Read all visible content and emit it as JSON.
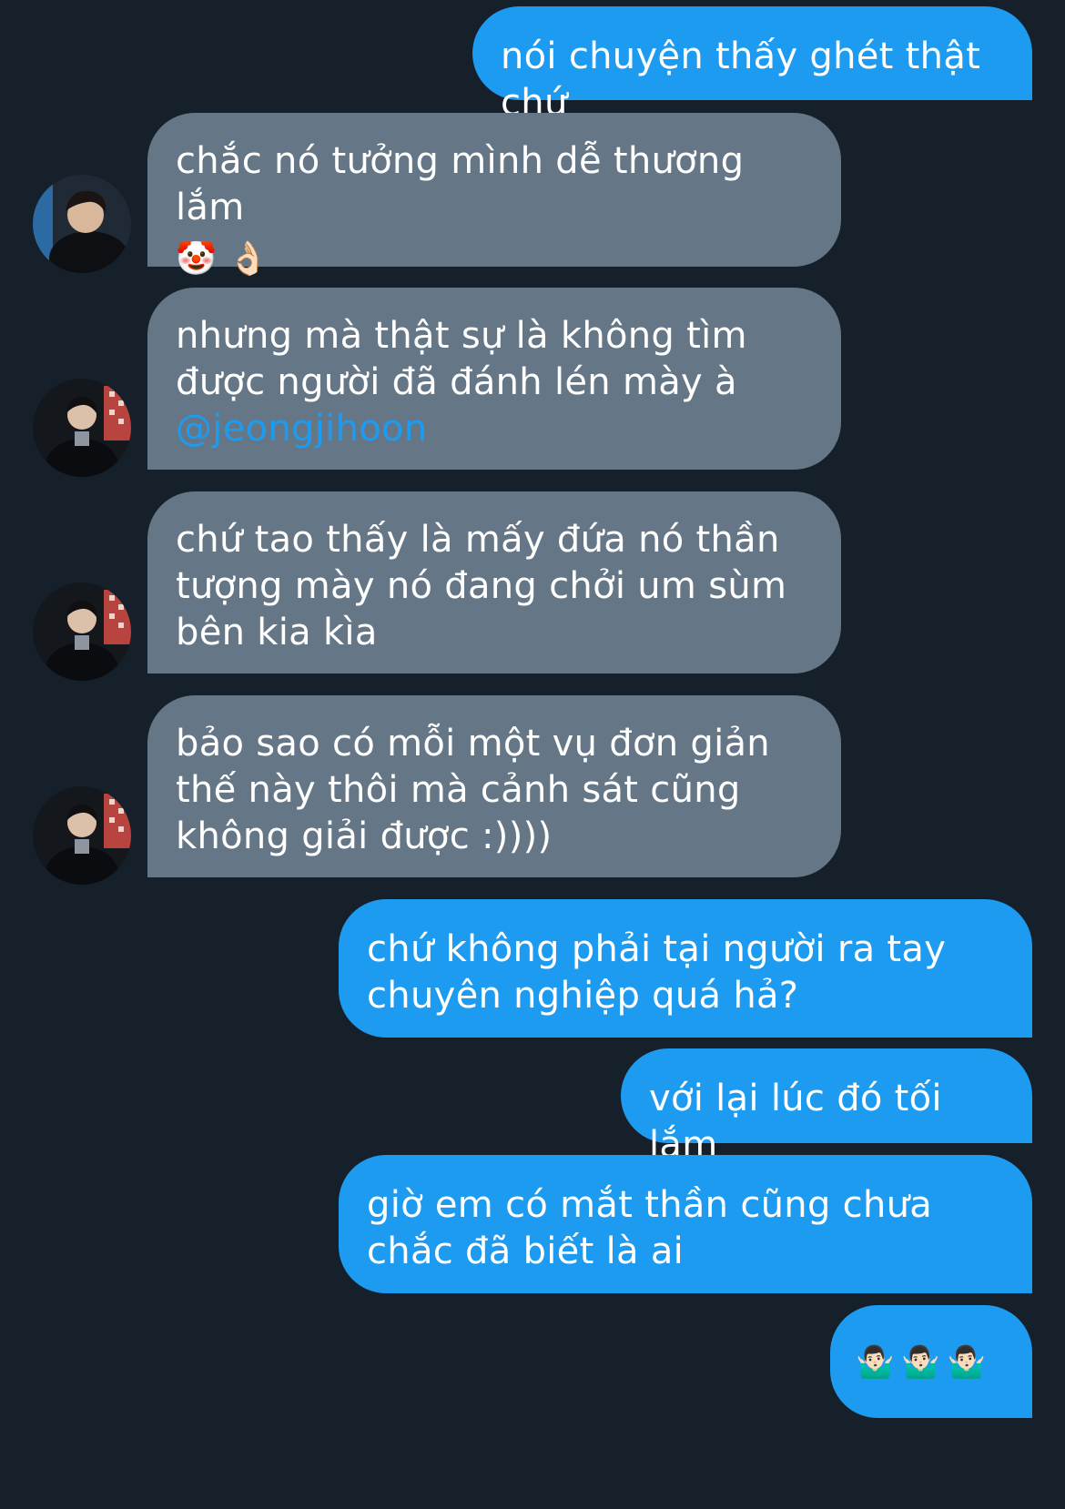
{
  "conversation": {
    "messages": [
      {
        "id": "m1",
        "direction": "sent",
        "text": "nói chuyện thấy ghét thật chứ"
      },
      {
        "id": "m2",
        "direction": "received",
        "text": "chắc nó tưởng mình dễ thương lắm",
        "emojis": [
          "🤡",
          "👌🏻"
        ],
        "avatar": "avatar-1"
      },
      {
        "id": "m3",
        "direction": "received",
        "text": "nhưng mà thật sự là không tìm được người đã đánh lén mày à",
        "mention": "@jeongjihoon",
        "avatar": "avatar-2"
      },
      {
        "id": "m4",
        "direction": "received",
        "text": "chứ tao thấy là mấy đứa nó thần tượng mày nó đang chởi um sùm bên kia kìa",
        "avatar": "avatar-2"
      },
      {
        "id": "m5",
        "direction": "received",
        "text": "bảo sao có mỗi một vụ đơn giản thế này thôi mà cảnh sát cũng không giải được :))))",
        "avatar": "avatar-2"
      },
      {
        "id": "m6",
        "direction": "sent",
        "text": "chứ không phải tại người ra tay chuyên nghiệp quá hả?"
      },
      {
        "id": "m7",
        "direction": "sent",
        "text": "với lại lúc đó tối lắm"
      },
      {
        "id": "m8",
        "direction": "sent",
        "text": "giờ em có mắt thần cũng chưa chắc đã biết là ai"
      },
      {
        "id": "m9",
        "direction": "sent",
        "text": "🤷🏻‍♂️🤷🏻‍♂️🤷🏻‍♂️"
      }
    ]
  },
  "colors": {
    "background": "#15202b",
    "sent_bubble": "#1d9bf0",
    "received_bubble": "#657786",
    "mention": "#1d9bf0",
    "text": "#ffffff"
  }
}
